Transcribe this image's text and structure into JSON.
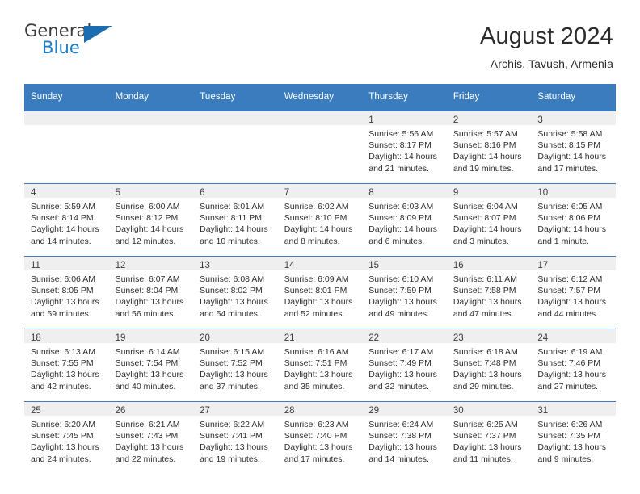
{
  "brand": {
    "name_part1": "General",
    "name_part2": "Blue",
    "accent_color": "#1d7fc4",
    "triangle_color": "#1b6cb0"
  },
  "header": {
    "title": "August 2024",
    "subtitle": "Archis, Tavush, Armenia"
  },
  "theme": {
    "header_bg": "#3a7cbe",
    "daynum_bg": "#efefef",
    "text_color": "#2e2e2e"
  },
  "calendar": {
    "weekday_headers": [
      "Sunday",
      "Monday",
      "Tuesday",
      "Wednesday",
      "Thursday",
      "Friday",
      "Saturday"
    ],
    "weeks": [
      [
        {
          "day": "",
          "lines": []
        },
        {
          "day": "",
          "lines": []
        },
        {
          "day": "",
          "lines": []
        },
        {
          "day": "",
          "lines": []
        },
        {
          "day": "1",
          "lines": [
            "Sunrise: 5:56 AM",
            "Sunset: 8:17 PM",
            "Daylight: 14 hours",
            "and 21 minutes."
          ]
        },
        {
          "day": "2",
          "lines": [
            "Sunrise: 5:57 AM",
            "Sunset: 8:16 PM",
            "Daylight: 14 hours",
            "and 19 minutes."
          ]
        },
        {
          "day": "3",
          "lines": [
            "Sunrise: 5:58 AM",
            "Sunset: 8:15 PM",
            "Daylight: 14 hours",
            "and 17 minutes."
          ]
        }
      ],
      [
        {
          "day": "4",
          "lines": [
            "Sunrise: 5:59 AM",
            "Sunset: 8:14 PM",
            "Daylight: 14 hours",
            "and 14 minutes."
          ]
        },
        {
          "day": "5",
          "lines": [
            "Sunrise: 6:00 AM",
            "Sunset: 8:12 PM",
            "Daylight: 14 hours",
            "and 12 minutes."
          ]
        },
        {
          "day": "6",
          "lines": [
            "Sunrise: 6:01 AM",
            "Sunset: 8:11 PM",
            "Daylight: 14 hours",
            "and 10 minutes."
          ]
        },
        {
          "day": "7",
          "lines": [
            "Sunrise: 6:02 AM",
            "Sunset: 8:10 PM",
            "Daylight: 14 hours",
            "and 8 minutes."
          ]
        },
        {
          "day": "8",
          "lines": [
            "Sunrise: 6:03 AM",
            "Sunset: 8:09 PM",
            "Daylight: 14 hours",
            "and 6 minutes."
          ]
        },
        {
          "day": "9",
          "lines": [
            "Sunrise: 6:04 AM",
            "Sunset: 8:07 PM",
            "Daylight: 14 hours",
            "and 3 minutes."
          ]
        },
        {
          "day": "10",
          "lines": [
            "Sunrise: 6:05 AM",
            "Sunset: 8:06 PM",
            "Daylight: 14 hours",
            "and 1 minute."
          ]
        }
      ],
      [
        {
          "day": "11",
          "lines": [
            "Sunrise: 6:06 AM",
            "Sunset: 8:05 PM",
            "Daylight: 13 hours",
            "and 59 minutes."
          ]
        },
        {
          "day": "12",
          "lines": [
            "Sunrise: 6:07 AM",
            "Sunset: 8:04 PM",
            "Daylight: 13 hours",
            "and 56 minutes."
          ]
        },
        {
          "day": "13",
          "lines": [
            "Sunrise: 6:08 AM",
            "Sunset: 8:02 PM",
            "Daylight: 13 hours",
            "and 54 minutes."
          ]
        },
        {
          "day": "14",
          "lines": [
            "Sunrise: 6:09 AM",
            "Sunset: 8:01 PM",
            "Daylight: 13 hours",
            "and 52 minutes."
          ]
        },
        {
          "day": "15",
          "lines": [
            "Sunrise: 6:10 AM",
            "Sunset: 7:59 PM",
            "Daylight: 13 hours",
            "and 49 minutes."
          ]
        },
        {
          "day": "16",
          "lines": [
            "Sunrise: 6:11 AM",
            "Sunset: 7:58 PM",
            "Daylight: 13 hours",
            "and 47 minutes."
          ]
        },
        {
          "day": "17",
          "lines": [
            "Sunrise: 6:12 AM",
            "Sunset: 7:57 PM",
            "Daylight: 13 hours",
            "and 44 minutes."
          ]
        }
      ],
      [
        {
          "day": "18",
          "lines": [
            "Sunrise: 6:13 AM",
            "Sunset: 7:55 PM",
            "Daylight: 13 hours",
            "and 42 minutes."
          ]
        },
        {
          "day": "19",
          "lines": [
            "Sunrise: 6:14 AM",
            "Sunset: 7:54 PM",
            "Daylight: 13 hours",
            "and 40 minutes."
          ]
        },
        {
          "day": "20",
          "lines": [
            "Sunrise: 6:15 AM",
            "Sunset: 7:52 PM",
            "Daylight: 13 hours",
            "and 37 minutes."
          ]
        },
        {
          "day": "21",
          "lines": [
            "Sunrise: 6:16 AM",
            "Sunset: 7:51 PM",
            "Daylight: 13 hours",
            "and 35 minutes."
          ]
        },
        {
          "day": "22",
          "lines": [
            "Sunrise: 6:17 AM",
            "Sunset: 7:49 PM",
            "Daylight: 13 hours",
            "and 32 minutes."
          ]
        },
        {
          "day": "23",
          "lines": [
            "Sunrise: 6:18 AM",
            "Sunset: 7:48 PM",
            "Daylight: 13 hours",
            "and 29 minutes."
          ]
        },
        {
          "day": "24",
          "lines": [
            "Sunrise: 6:19 AM",
            "Sunset: 7:46 PM",
            "Daylight: 13 hours",
            "and 27 minutes."
          ]
        }
      ],
      [
        {
          "day": "25",
          "lines": [
            "Sunrise: 6:20 AM",
            "Sunset: 7:45 PM",
            "Daylight: 13 hours",
            "and 24 minutes."
          ]
        },
        {
          "day": "26",
          "lines": [
            "Sunrise: 6:21 AM",
            "Sunset: 7:43 PM",
            "Daylight: 13 hours",
            "and 22 minutes."
          ]
        },
        {
          "day": "27",
          "lines": [
            "Sunrise: 6:22 AM",
            "Sunset: 7:41 PM",
            "Daylight: 13 hours",
            "and 19 minutes."
          ]
        },
        {
          "day": "28",
          "lines": [
            "Sunrise: 6:23 AM",
            "Sunset: 7:40 PM",
            "Daylight: 13 hours",
            "and 17 minutes."
          ]
        },
        {
          "day": "29",
          "lines": [
            "Sunrise: 6:24 AM",
            "Sunset: 7:38 PM",
            "Daylight: 13 hours",
            "and 14 minutes."
          ]
        },
        {
          "day": "30",
          "lines": [
            "Sunrise: 6:25 AM",
            "Sunset: 7:37 PM",
            "Daylight: 13 hours",
            "and 11 minutes."
          ]
        },
        {
          "day": "31",
          "lines": [
            "Sunrise: 6:26 AM",
            "Sunset: 7:35 PM",
            "Daylight: 13 hours",
            "and 9 minutes."
          ]
        }
      ]
    ]
  }
}
